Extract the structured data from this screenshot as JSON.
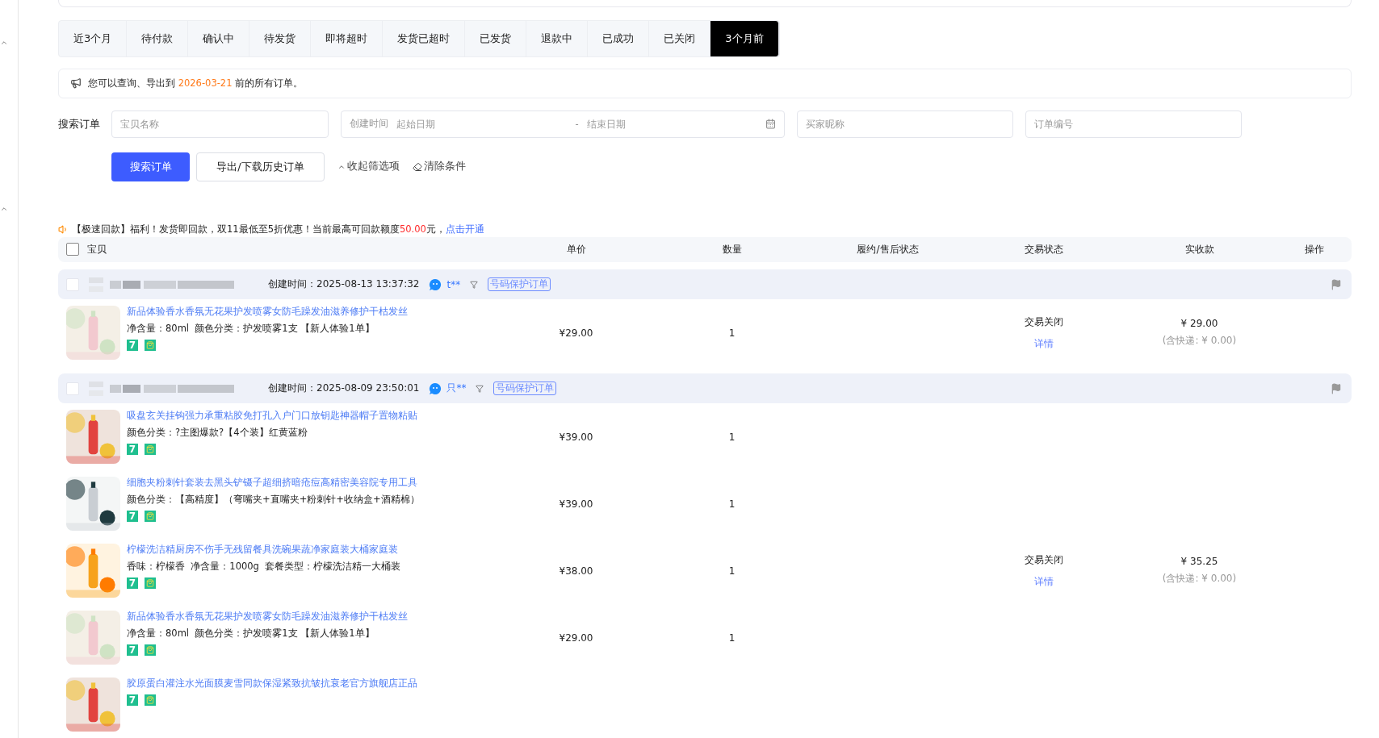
{
  "tabs": [
    {
      "label": "近3个月",
      "selected": false
    },
    {
      "label": "待付款",
      "selected": false
    },
    {
      "label": "确认中",
      "selected": false
    },
    {
      "label": "待发货",
      "selected": false
    },
    {
      "label": "即将超时",
      "selected": false
    },
    {
      "label": "发货已超时",
      "selected": false
    },
    {
      "label": "已发货",
      "selected": false
    },
    {
      "label": "退款中",
      "selected": false
    },
    {
      "label": "已成功",
      "selected": false
    },
    {
      "label": "已关闭",
      "selected": false
    },
    {
      "label": "3个月前",
      "selected": true
    }
  ],
  "notice": {
    "before": "您可以查询、导出到",
    "date": "2026-03-21",
    "after": "前的所有订单。"
  },
  "search": {
    "label": "搜索订单",
    "product_placeholder": "宝贝名称",
    "created_label": "创建时间",
    "start_placeholder": "起始日期",
    "range_separator": "-",
    "end_placeholder": "结束日期",
    "buyer_placeholder": "买家昵称",
    "order_placeholder": "订单编号",
    "search_button": "搜索订单",
    "export_button": "导出/下载历史订单",
    "collapse_link": "收起筛选项",
    "clear_link": "清除条件"
  },
  "promo": {
    "text": "【极速回款】福利！发货即回款，双11最低至5折优惠！当前最高可回款额度",
    "amount": "50.00",
    "suffix": "元，",
    "link": "点击开通"
  },
  "table": {
    "select_all_checked": false,
    "columns": [
      "宝贝",
      "单价",
      "数量",
      "履约/售后状态",
      "交易状态",
      "实收款",
      "操作"
    ]
  },
  "orders": [
    {
      "checked": false,
      "created": "创建时间：2025-08-13 13:37:32",
      "buyer": "t**",
      "tag": "号码保护订单",
      "status": "交易关闭",
      "detail": "详情",
      "total": "¥ 29.00",
      "shipping": "(含快递: ¥ 0.00)",
      "items": [
        {
          "title": "新品体验香水香氛无花果护发喷雾女防毛躁发油滋养修护干枯发丝",
          "spec": "净含量：80ml  颜色分类：护发喷雾1支 【新人体验1单】",
          "badge": "7",
          "price": "¥29.00",
          "qty": "1"
        }
      ]
    },
    {
      "checked": false,
      "created": "创建时间：2025-08-09 23:50:01",
      "buyer": "只**",
      "tag": "号码保护订单",
      "status": "交易关闭",
      "detail": "详情",
      "total": "¥ 35.25",
      "shipping": "(含快递: ¥ 0.00)",
      "items": [
        {
          "title": "吸盘玄关挂钩强力承重粘胶免打孔入户门口放钥匙神器帽子置物粘贴",
          "spec": "颜色分类：?主图爆款?【4个装】红黄蓝粉",
          "badge": "7",
          "price": "¥39.00",
          "qty": "1"
        },
        {
          "title": "细胞夹粉刺针套装去黑头铲镊子超细挤暗疮痘高精密美容院专用工具",
          "spec": "颜色分类：【高精度】（弯嘴夹+直嘴夹+粉刺针+收纳盒+酒精棉）",
          "badge": "7",
          "price": "¥39.00",
          "qty": "1"
        },
        {
          "title": "柠檬洗洁精厨房不伤手无残留餐具洗碗果蔬净家庭装大桶家庭装",
          "spec": "香味：柠檬香  净含量：1000g  套餐类型：柠檬洗洁精一大桶装",
          "badge": "7",
          "price": "¥38.00",
          "qty": "1"
        },
        {
          "title": "新品体验香水香氛无花果护发喷雾女防毛躁发油滋养修护干枯发丝",
          "spec": "净含量：80ml  颜色分类：护发喷雾1支 【新人体验1单】",
          "badge": "7",
          "price": "¥29.00",
          "qty": "1"
        },
        {
          "title": "胶原蛋白灌注水光面膜麦雪同款保湿紧致抗皱抗衰老官方旗舰店正品",
          "badge": "7"
        }
      ]
    }
  ]
}
